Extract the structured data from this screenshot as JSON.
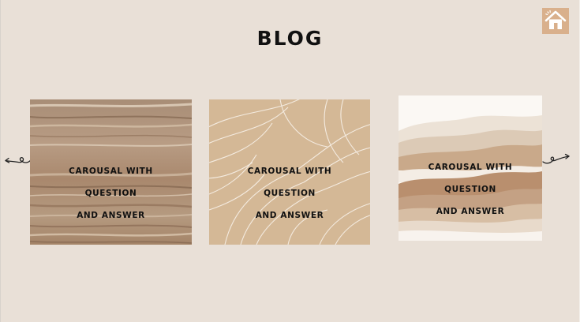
{
  "page": {
    "title": "BLOG",
    "background_color": "#e9e0d7"
  },
  "home_button": {
    "icon": "home-icon",
    "color": "#d9b08c"
  },
  "carousel": {
    "prev_icon": "curly-arrow-left-icon",
    "next_icon": "curly-arrow-right-icon",
    "cards": [
      {
        "background": "beige-travertine-marble",
        "line1": "CAROUSAL WITH",
        "line2": "QUESTION",
        "line3": "AND ANSWER"
      },
      {
        "background": "line-art-leaves",
        "line1": "CAROUSAL WITH",
        "line2": "QUESTION",
        "line3": "AND ANSWER"
      },
      {
        "background": "watercolor-brown-mountains",
        "line1": "CAROUSAL WITH",
        "line2": "QUESTION",
        "line3": "AND ANSWER"
      }
    ]
  }
}
